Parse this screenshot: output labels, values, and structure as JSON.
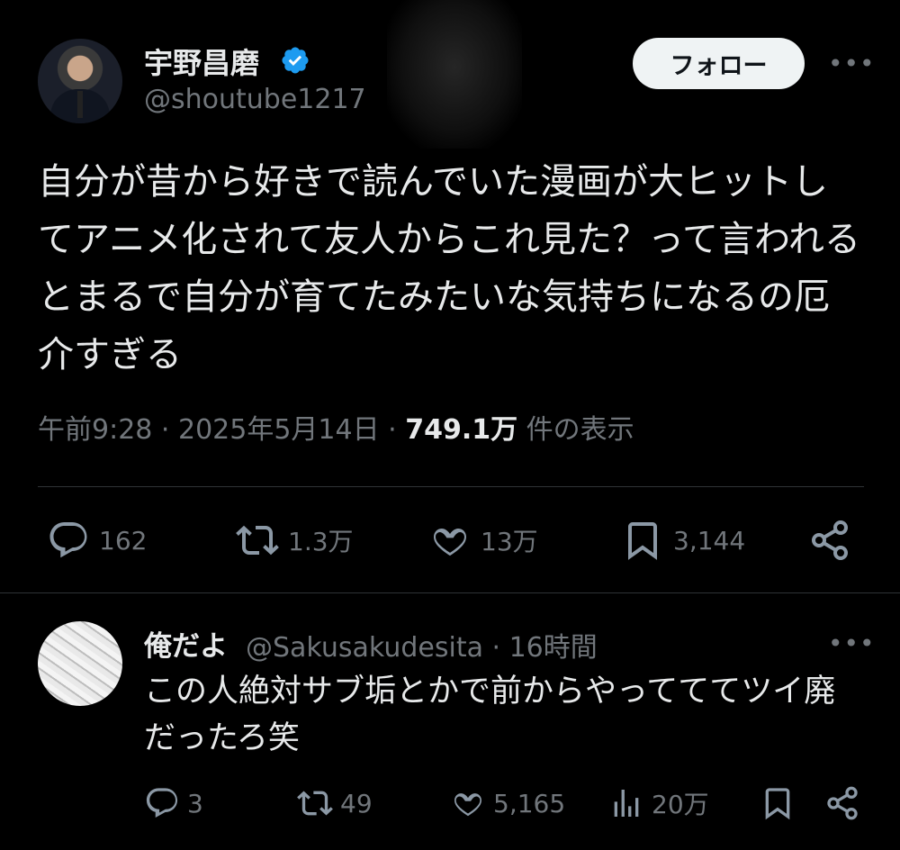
{
  "author": {
    "name": "宇野昌磨",
    "handle": "@shoutube1217",
    "verified": true
  },
  "follow_label": "フォロー",
  "more_label": "•••",
  "tweet": {
    "text": "自分が昔から好きで読んでいた漫画が大ヒットしてアニメ化されて友人からこれ見た？って言われるとまるで自分が育てたみたいな気持ちになるの厄介すぎる",
    "time": "午前9:28 · 2025年5月14日 · ",
    "views": "749.1万",
    "views_suffix": " 件の表示"
  },
  "actions": {
    "replies": "162",
    "retweets": "1.3万",
    "likes": "13万",
    "bookmarks": "3,144"
  },
  "reply": {
    "name": "俺だよ",
    "handle_time": "@Sakusakudesita · 16時間",
    "text": "この人絶対サブ垢とかで前からやってててツイ廃だったろ笑",
    "replies": "3",
    "retweets": "49",
    "likes": "5,165",
    "views": "20万"
  },
  "colors": {
    "background": "#000000",
    "text": "#e7e9ea",
    "muted": "#71767b",
    "divider": "#2f3336",
    "verified": "#1d9bf0"
  }
}
